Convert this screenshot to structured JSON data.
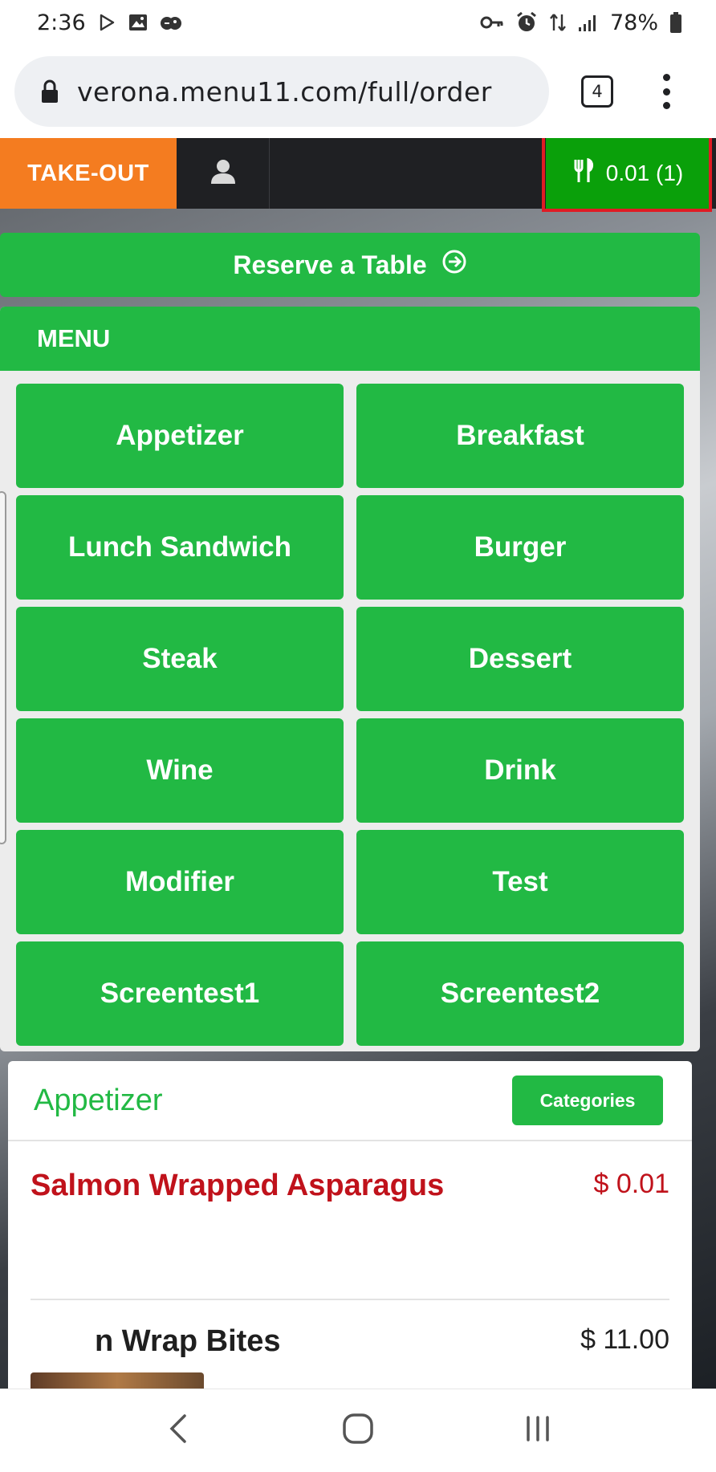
{
  "status_bar": {
    "time": "2:36",
    "battery": "78%"
  },
  "browser": {
    "url": "verona.menu11.com/full/order",
    "tab_count": "4"
  },
  "site_nav": {
    "takeout_label": "TAKE-OUT",
    "cart_label": "0.01 (1)"
  },
  "reserve": {
    "label": "Reserve a Table"
  },
  "menu": {
    "header": "MENU",
    "categories": [
      "Appetizer",
      "Breakfast",
      "Lunch Sandwich",
      "Burger",
      "Steak",
      "Dessert",
      "Wine",
      "Drink",
      "Modifier",
      "Test",
      "Screentest1",
      "Screentest2"
    ]
  },
  "section": {
    "title": "Appetizer",
    "categories_button": "Categories",
    "items": [
      {
        "name": "Salmon Wrapped Asparagus",
        "price": "$ 0.01"
      },
      {
        "name": "n Wrap Bites",
        "price": "$ 11.00"
      }
    ]
  },
  "colors": {
    "accent_green": "#22b944",
    "cart_green": "#0aa00a",
    "takeout_orange": "#f47c20",
    "highlight_red": "#e01b24",
    "item_red": "#c0121b",
    "a11y_blue": "#0a55a8"
  },
  "icons": {
    "play": "play-store-icon",
    "gallery": "image-icon",
    "games": "game-controller-icon",
    "key": "key-icon",
    "alarm": "alarm-icon",
    "signal": "signal-icon",
    "battery": "battery-icon",
    "lock": "lock-icon",
    "user": "user-icon",
    "cutlery": "cutlery-icon",
    "arrow": "arrow-circle-right-icon",
    "accessibility": "accessibility-icon",
    "back": "back-icon",
    "home": "home-icon",
    "recents": "recents-icon"
  }
}
